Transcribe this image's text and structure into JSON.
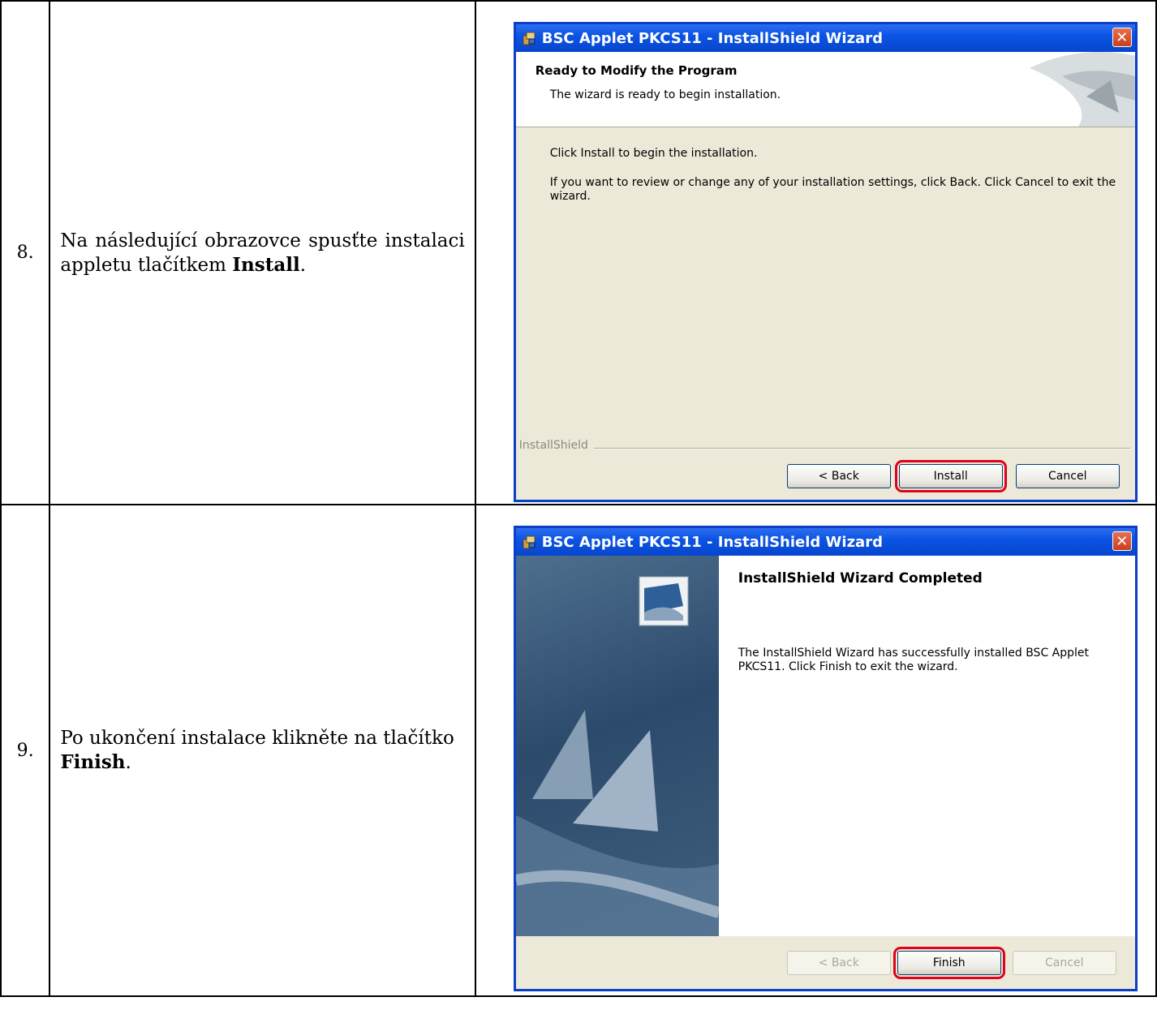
{
  "steps": [
    {
      "number": "8.",
      "text_before": "Na následující obrazovce spusťte instalaci appletu tlačítkem ",
      "text_bold": "Install",
      "text_after": ".",
      "wizard": {
        "title": "BSC Applet PKCS11 - InstallShield Wizard",
        "heading": "Ready to Modify the Program",
        "subheading": "The wizard is ready to begin installation.",
        "paragraph1": "Click Install to begin the installation.",
        "paragraph2": "If you want to review or change any of your installation settings, click Back. Click Cancel to exit the wizard.",
        "brand": "InstallShield",
        "buttons": {
          "back": "< Back",
          "primary": "Install",
          "cancel": "Cancel"
        }
      }
    },
    {
      "number": "9.",
      "text_before": "Po ukončení instalace klikněte na tlačítko ",
      "text_bold": "Finish",
      "text_after": ".",
      "wizard": {
        "title": "BSC Applet PKCS11 - InstallShield Wizard",
        "heading": "InstallShield Wizard Completed",
        "paragraph1": "The InstallShield Wizard has successfully installed BSC Applet PKCS11. Click Finish to exit the wizard.",
        "buttons": {
          "back": "< Back",
          "primary": "Finish",
          "cancel": "Cancel"
        }
      }
    }
  ],
  "colors": {
    "titlebar": "#0b54e3",
    "dialog_face": "#ece9d8",
    "highlight_outline": "#e2001a",
    "close_button": "#c8401c"
  }
}
